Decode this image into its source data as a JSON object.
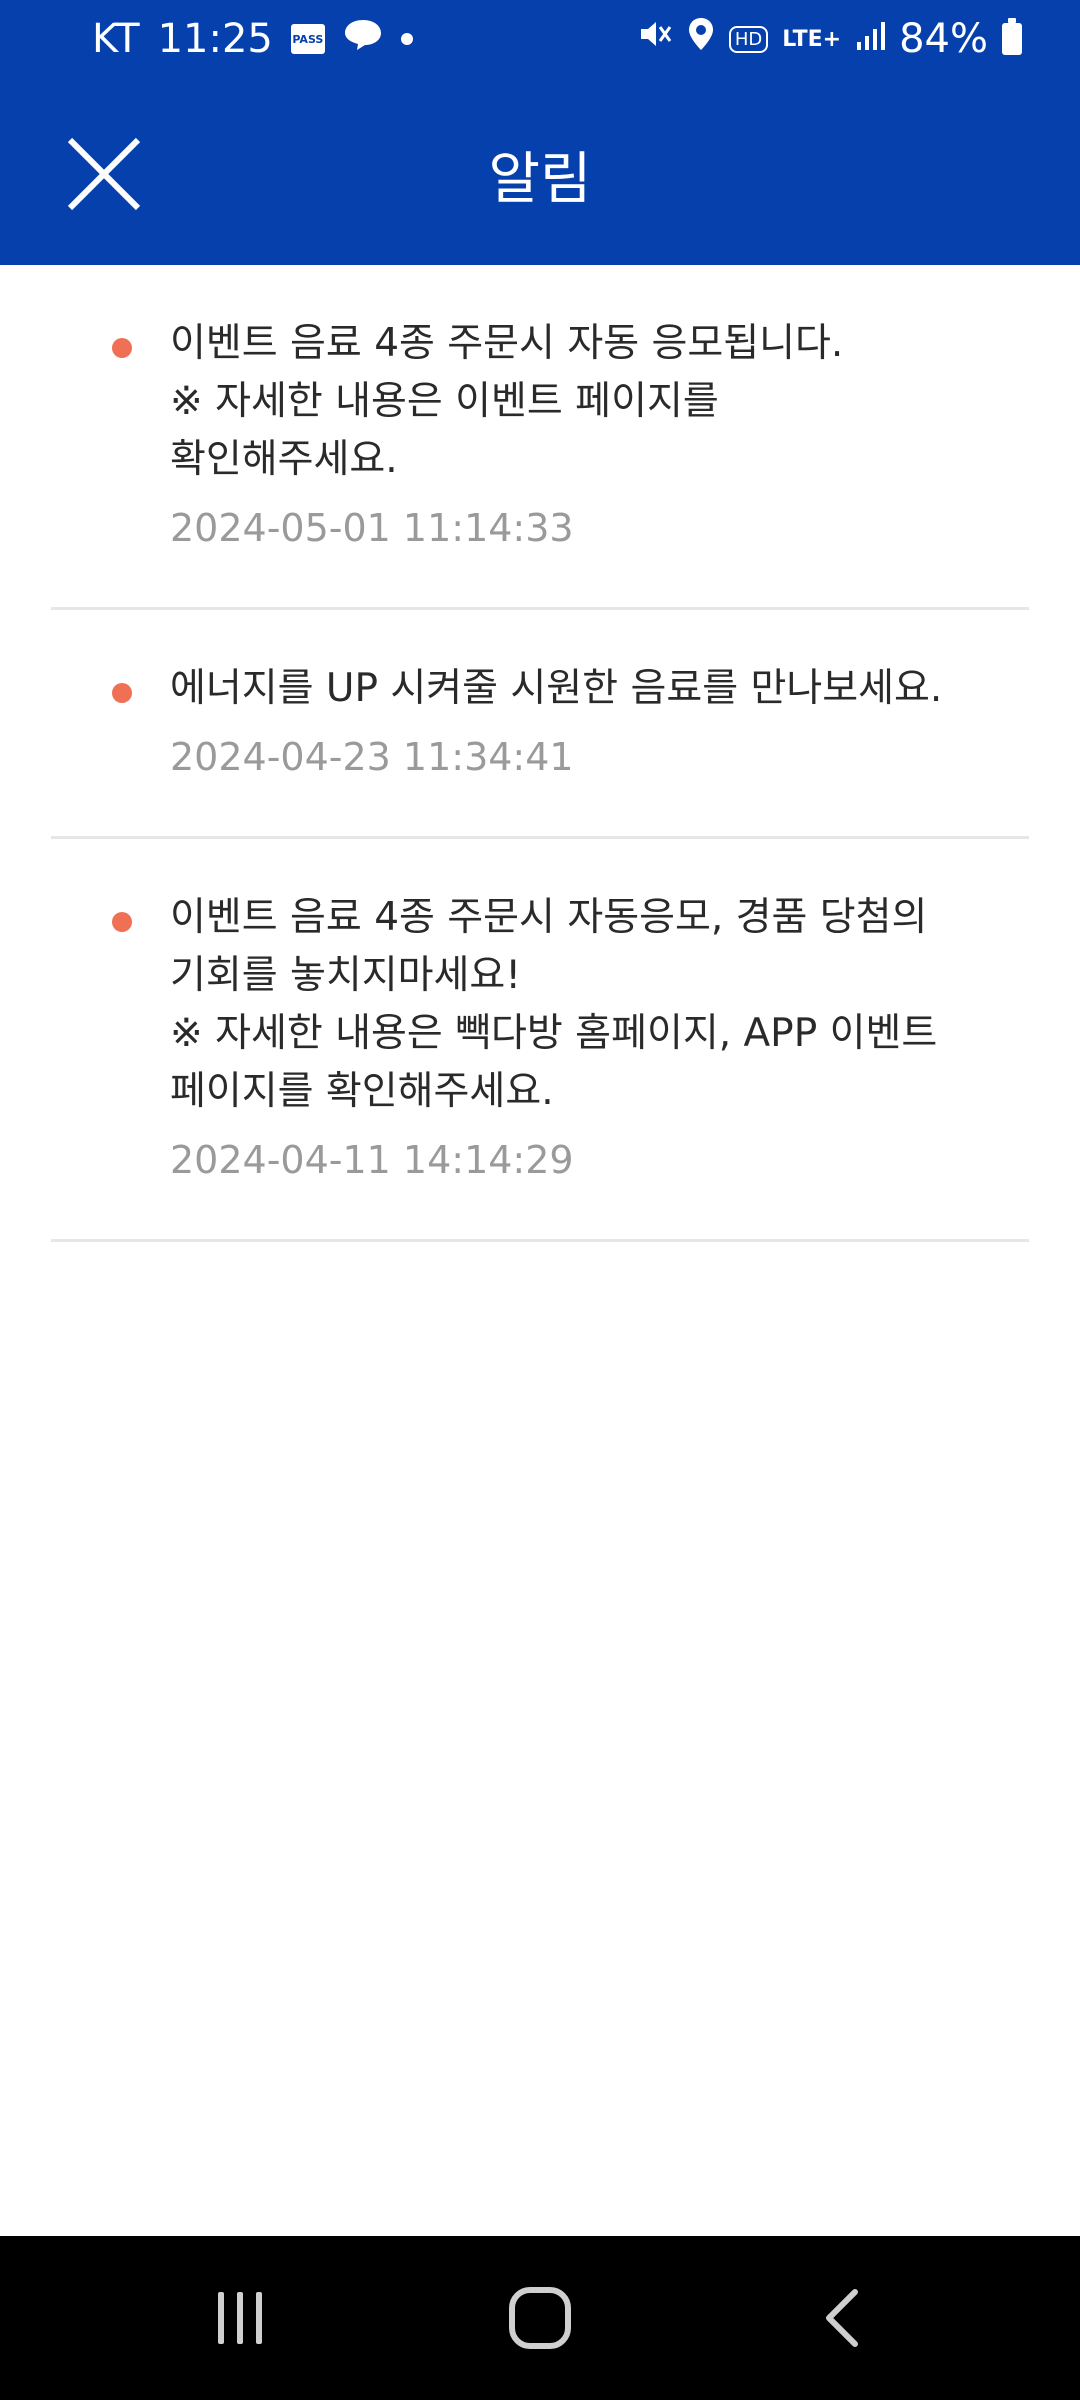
{
  "status_bar": {
    "carrier": "KT",
    "time": "11:25",
    "pass_label": "PASS",
    "network": "LTE+",
    "hd_label": "HD",
    "battery": "84%"
  },
  "header": {
    "title": "알림"
  },
  "notifications": [
    {
      "text": "이벤트 음료 4종 주문시 자동 응모됩니다.\n※ 자세한 내용은 이벤트 페이지를\n확인해주세요.",
      "date": "2024-05-01 11:14:33"
    },
    {
      "text": "에너지를 UP 시켜줄 시원한 음료를 만나보세요.",
      "date": "2024-04-23 11:34:41"
    },
    {
      "text": "이벤트 음료 4종 주문시 자동응모, 경품 당첨의\n기회를 놓치지마세요!\n※ 자세한 내용은 빽다방 홈페이지, APP 이벤트\n페이지를 확인해주세요.",
      "date": "2024-04-11 14:14:29"
    }
  ],
  "colors": {
    "header_bg": "#0540ad",
    "bullet": "#f07056",
    "date_text": "#9a9a9a",
    "divider": "#e6e6e6"
  }
}
